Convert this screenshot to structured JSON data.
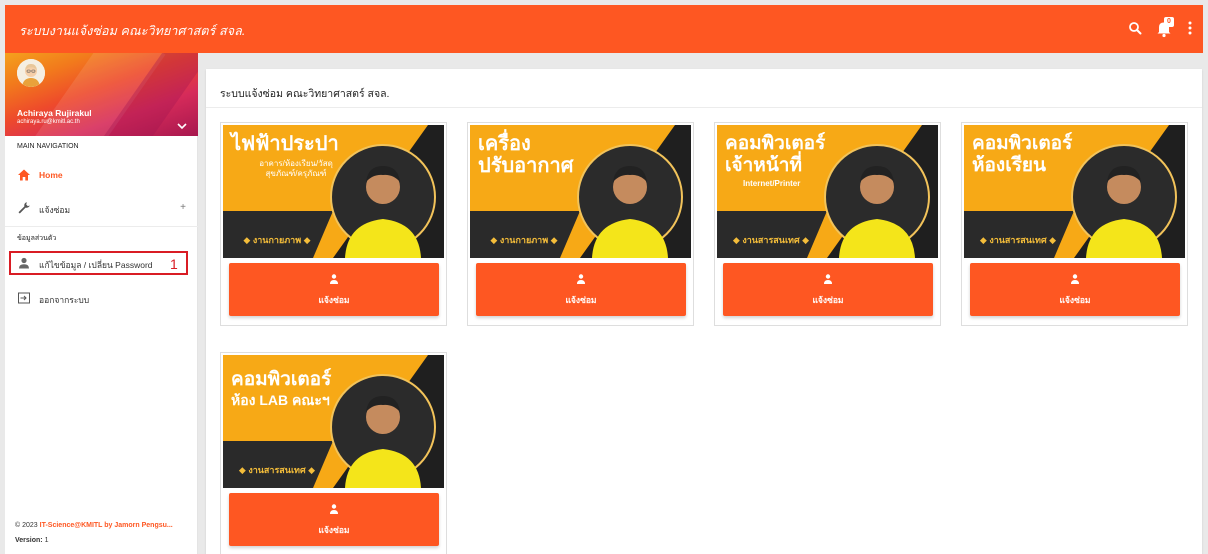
{
  "app": {
    "title": "ระบบงานแจ้งซ่อม คณะวิทยาศาสตร์ สจล."
  },
  "topbar": {
    "notification_count": "0",
    "icons": [
      "search-icon",
      "bell-icon",
      "more-vert-icon"
    ]
  },
  "user": {
    "name": "Achiraya Rujirakul",
    "email": "achiraya.ru@kmitl.ac.th"
  },
  "nav": {
    "header_main": "MAIN NAVIGATION",
    "home": "Home",
    "repair": "แจ้งซ่อม",
    "repair_expand": "+",
    "header_personal": "ข้อมูลส่วนตัว",
    "edit_profile": "แก้ไขข้อมูล / เปลี่ยน Password",
    "logout": "ออกจากระบบ"
  },
  "annotation": {
    "label": "1"
  },
  "footer": {
    "copyright": "© 2023 ",
    "credit": "IT-Science@KMITL by Jamorn Pengsu...",
    "version_label": "Version: ",
    "version_value": "1"
  },
  "main": {
    "page_title": "ระบบแจ้งซ่อม คณะวิทยาศาสตร์ สจล.",
    "cards": [
      {
        "title_line1": "ไฟฟ้าประปา",
        "title_line2": "",
        "subtitle": "อาคาร/ห้องเรียน/วัสดุ",
        "subtitle2": "สุขภัณฑ์/ครุภัณฑ์",
        "department": "◆ งานกายภาพ ◆",
        "button": "แจ้งซ่อม"
      },
      {
        "title_line1": "เครื่อง",
        "title_line2": "ปรับอากาศ",
        "subtitle": "",
        "subtitle2": "",
        "department": "◆ งานกายภาพ ◆",
        "button": "แจ้งซ่อม"
      },
      {
        "title_line1": "คอมพิวเตอร์",
        "title_line2": "เจ้าหน้าที่",
        "subtitle": "Internet/Printer",
        "subtitle2": "",
        "department": "◆ งานสารสนเทศ ◆",
        "button": "แจ้งซ่อม"
      },
      {
        "title_line1": "คอมพิวเตอร์",
        "title_line2": "ห้องเรียน",
        "subtitle": "",
        "subtitle2": "",
        "department": "◆ งานสารสนเทศ ◆",
        "button": "แจ้งซ่อม"
      },
      {
        "title_line1": "คอมพิวเตอร์",
        "title_line2": "ห้อง LAB คณะฯ",
        "subtitle": "",
        "subtitle2": "",
        "department": "◆ งานสารสนเทศ ◆",
        "button": "แจ้งซ่อม"
      }
    ]
  },
  "colors": {
    "primary": "#fe5722",
    "banner_yellow": "#f7a916",
    "banner_dark": "#1f1f1f",
    "shirt_yellow": "#f4e51a",
    "annotation_red": "#d91c24"
  }
}
